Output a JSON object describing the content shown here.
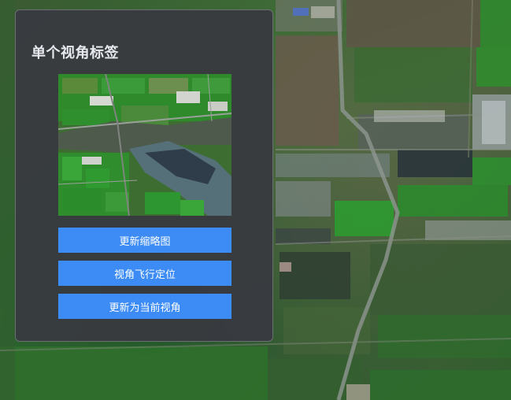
{
  "panel": {
    "title": "单个视角标签",
    "thumbnail_alt": "thumbnail-image",
    "buttons": {
      "update_thumbnail": "更新缩略图",
      "fly_to_view": "视角飞行定位",
      "update_to_current": "更新为当前视角"
    }
  },
  "colors": {
    "panel_bg": "#3a3c42",
    "button_blue": "#3d8cf5",
    "title_text": "#e7e9ee"
  }
}
